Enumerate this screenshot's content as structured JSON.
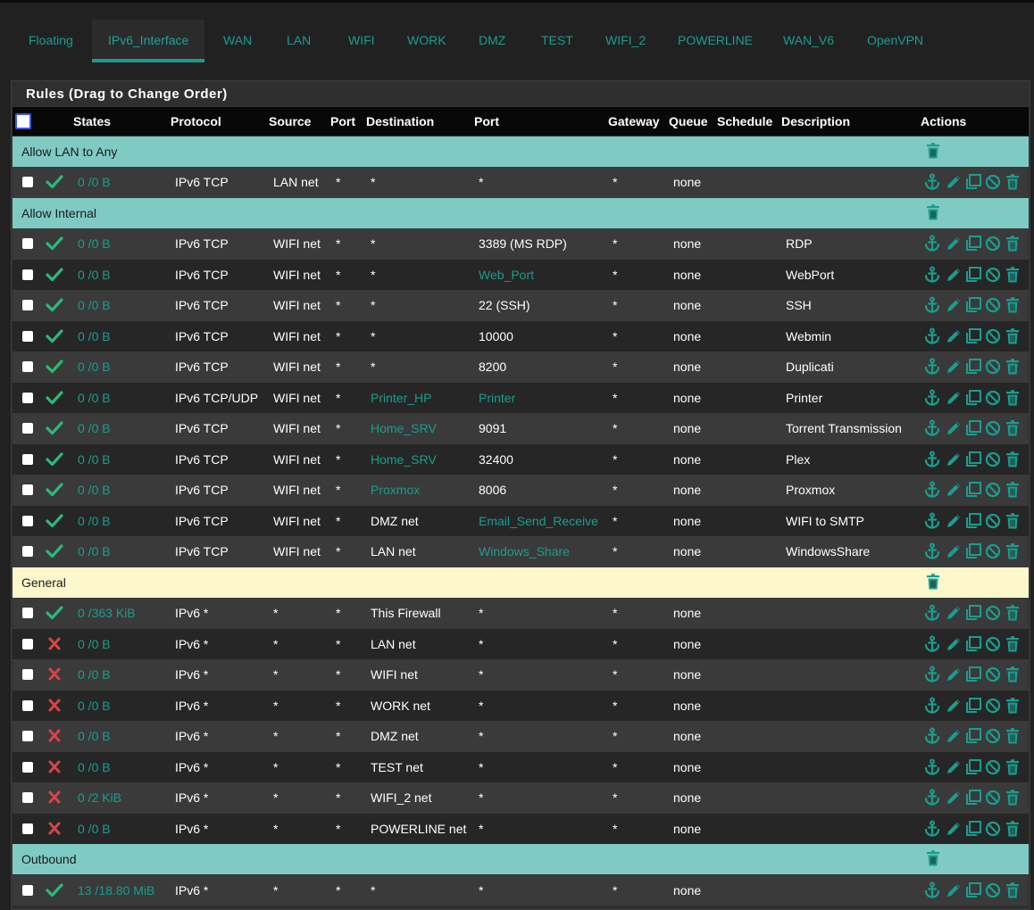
{
  "tabs": [
    "Floating",
    "IPv6_Interface",
    "WAN",
    "LAN",
    "WIFI",
    "WORK",
    "DMZ",
    "TEST",
    "WIFI_2",
    "POWERLINE",
    "WAN_V6",
    "OpenVPN"
  ],
  "active_tab": "IPv6_Interface",
  "panel": {
    "title": "Rules (Drag to Change Order)"
  },
  "columns": {
    "states": "States",
    "protocol": "Protocol",
    "source": "Source",
    "sport": "Port",
    "destination": "Destination",
    "dport": "Port",
    "gateway": "Gateway",
    "queue": "Queue",
    "schedule": "Schedule",
    "description": "Description",
    "actions": "Actions"
  },
  "colors": {
    "accent": "#1a9d8f",
    "pass": "#2bb97a",
    "block": "#d64545",
    "group_bg": "#7fcbc3",
    "group_general_bg": "#fcf8cc"
  },
  "icons": {
    "pass": "check-icon",
    "block": "x-icon",
    "actions": [
      "anchor-icon",
      "pencil-icon",
      "copy-icon",
      "disable-icon",
      "trash-icon"
    ]
  },
  "groups": [
    {
      "label": "Allow LAN to Any",
      "style": "teal",
      "rules": [
        {
          "status": "pass",
          "states": "0 /0 B",
          "protocol": "IPv6 TCP",
          "source": "LAN net",
          "sport": "*",
          "destination": "*",
          "dport": "*",
          "gateway": "*",
          "queue": "none",
          "description": ""
        }
      ]
    },
    {
      "label": "Allow Internal",
      "style": "teal",
      "rules": [
        {
          "status": "pass",
          "states": "0 /0 B",
          "protocol": "IPv6 TCP",
          "source": "WIFI net",
          "sport": "*",
          "destination": "*",
          "dport": "3389 (MS RDP)",
          "gateway": "*",
          "queue": "none",
          "description": "RDP"
        },
        {
          "status": "pass",
          "states": "0 /0 B",
          "protocol": "IPv6 TCP",
          "source": "WIFI net",
          "sport": "*",
          "destination": "*",
          "dport": "Web_Port",
          "dport_link": true,
          "gateway": "*",
          "queue": "none",
          "description": "WebPort"
        },
        {
          "status": "pass",
          "states": "0 /0 B",
          "protocol": "IPv6 TCP",
          "source": "WIFI net",
          "sport": "*",
          "destination": "*",
          "dport": "22 (SSH)",
          "gateway": "*",
          "queue": "none",
          "description": "SSH"
        },
        {
          "status": "pass",
          "states": "0 /0 B",
          "protocol": "IPv6 TCP",
          "source": "WIFI net",
          "sport": "*",
          "destination": "*",
          "dport": "10000",
          "gateway": "*",
          "queue": "none",
          "description": "Webmin"
        },
        {
          "status": "pass",
          "states": "0 /0 B",
          "protocol": "IPv6 TCP",
          "source": "WIFI net",
          "sport": "*",
          "destination": "*",
          "dport": "8200",
          "gateway": "*",
          "queue": "none",
          "description": "Duplicati"
        },
        {
          "status": "pass",
          "states": "0 /0 B",
          "protocol": "IPv6 TCP/UDP",
          "source": "WIFI net",
          "sport": "*",
          "destination": "Printer_HP",
          "destination_link": true,
          "dport": "Printer",
          "dport_link": true,
          "gateway": "*",
          "queue": "none",
          "description": "Printer"
        },
        {
          "status": "pass",
          "states": "0 /0 B",
          "protocol": "IPv6 TCP",
          "source": "WIFI net",
          "sport": "*",
          "destination": "Home_SRV",
          "destination_link": true,
          "dport": "9091",
          "gateway": "*",
          "queue": "none",
          "description": "Torrent Transmission"
        },
        {
          "status": "pass",
          "states": "0 /0 B",
          "protocol": "IPv6 TCP",
          "source": "WIFI net",
          "sport": "*",
          "destination": "Home_SRV",
          "destination_link": true,
          "dport": "32400",
          "gateway": "*",
          "queue": "none",
          "description": "Plex"
        },
        {
          "status": "pass",
          "states": "0 /0 B",
          "protocol": "IPv6 TCP",
          "source": "WIFI net",
          "sport": "*",
          "destination": "Proxmox",
          "destination_link": true,
          "dport": "8006",
          "gateway": "*",
          "queue": "none",
          "description": "Proxmox"
        },
        {
          "status": "pass",
          "states": "0 /0 B",
          "protocol": "IPv6 TCP",
          "source": "WIFI net",
          "sport": "*",
          "destination": "DMZ net",
          "dport": "Email_Send_Receive",
          "dport_link": true,
          "gateway": "*",
          "queue": "none",
          "description": "WIFI to SMTP"
        },
        {
          "status": "pass",
          "states": "0 /0 B",
          "protocol": "IPv6 TCP",
          "source": "WIFI net",
          "sport": "*",
          "destination": "LAN net",
          "dport": "Windows_Share",
          "dport_link": true,
          "gateway": "*",
          "queue": "none",
          "description": "WindowsShare"
        }
      ]
    },
    {
      "label": "General",
      "style": "general",
      "rules": [
        {
          "status": "pass",
          "states": "0 /363 KiB",
          "protocol": "IPv6 *",
          "source": "*",
          "sport": "*",
          "destination": "This Firewall",
          "dport": "*",
          "gateway": "*",
          "queue": "none",
          "description": ""
        },
        {
          "status": "block",
          "states": "0 /0 B",
          "protocol": "IPv6 *",
          "source": "*",
          "sport": "*",
          "destination": "LAN net",
          "dport": "*",
          "gateway": "*",
          "queue": "none",
          "description": ""
        },
        {
          "status": "block",
          "states": "0 /0 B",
          "protocol": "IPv6 *",
          "source": "*",
          "sport": "*",
          "destination": "WIFI net",
          "dport": "*",
          "gateway": "*",
          "queue": "none",
          "description": ""
        },
        {
          "status": "block",
          "states": "0 /0 B",
          "protocol": "IPv6 *",
          "source": "*",
          "sport": "*",
          "destination": "WORK net",
          "dport": "*",
          "gateway": "*",
          "queue": "none",
          "description": ""
        },
        {
          "status": "block",
          "states": "0 /0 B",
          "protocol": "IPv6 *",
          "source": "*",
          "sport": "*",
          "destination": "DMZ net",
          "dport": "*",
          "gateway": "*",
          "queue": "none",
          "description": ""
        },
        {
          "status": "block",
          "states": "0 /0 B",
          "protocol": "IPv6 *",
          "source": "*",
          "sport": "*",
          "destination": "TEST net",
          "dport": "*",
          "gateway": "*",
          "queue": "none",
          "description": ""
        },
        {
          "status": "block",
          "states": "0 /2 KiB",
          "protocol": "IPv6 *",
          "source": "*",
          "sport": "*",
          "destination": "WIFI_2 net",
          "dport": "*",
          "gateway": "*",
          "queue": "none",
          "description": ""
        },
        {
          "status": "block",
          "states": "0 /0 B",
          "protocol": "IPv6 *",
          "source": "*",
          "sport": "*",
          "destination": "POWERLINE net",
          "dport": "*",
          "gateway": "*",
          "queue": "none",
          "description": ""
        }
      ]
    },
    {
      "label": "Outbound",
      "style": "teal",
      "rules": [
        {
          "status": "pass",
          "states": "13 /18.80 MiB",
          "protocol": "IPv6 *",
          "source": "*",
          "sport": "*",
          "destination": "*",
          "dport": "*",
          "gateway": "*",
          "queue": "none",
          "description": ""
        }
      ]
    }
  ]
}
